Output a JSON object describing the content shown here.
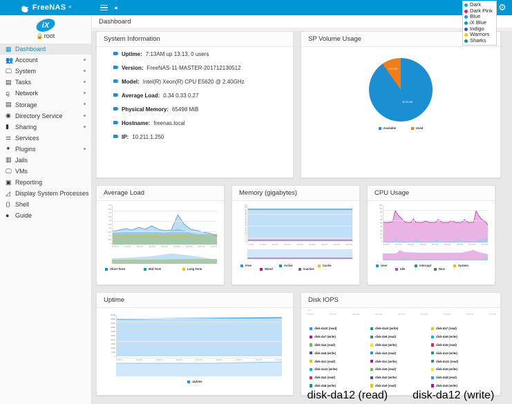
{
  "brand": {
    "name": "FreeNAS",
    "tm": "®"
  },
  "topbar": {
    "menu_icon": "hamburger-icon",
    "collapse_icon": "chevron-left-icon",
    "settings_icon": "gear-icon"
  },
  "theme_menu": {
    "items": [
      {
        "label": "Dark",
        "color": "#00a8e8"
      },
      {
        "label": "Dark Pink",
        "color": "#e91e63"
      },
      {
        "label": "Blue",
        "color": "#1e90ff"
      },
      {
        "label": "iX Blue",
        "color": "#0095d5"
      },
      {
        "label": "Indigo",
        "color": "#3f51b5"
      },
      {
        "label": "Warriors",
        "color": "#ffc107"
      },
      {
        "label": "Sharks",
        "color": "#009688"
      }
    ]
  },
  "breadcrumb": {
    "text": "Dashboard"
  },
  "sidebar": {
    "user": {
      "name": "root",
      "lock_icon": "lock-icon",
      "avatar": "ix-logo-avatar"
    },
    "items": [
      {
        "label": "Dashboard",
        "icon": "dashboard-icon",
        "glyph": "▦",
        "active": true,
        "expandable": false
      },
      {
        "label": "Account",
        "icon": "account-icon",
        "glyph": "👥",
        "active": false,
        "expandable": true
      },
      {
        "label": "System",
        "icon": "system-icon",
        "glyph": "🖵",
        "active": false,
        "expandable": true
      },
      {
        "label": "Tasks",
        "icon": "tasks-calendar-icon",
        "glyph": "▤",
        "active": false,
        "expandable": true
      },
      {
        "label": "Network",
        "icon": "network-icon",
        "glyph": "⚼",
        "active": false,
        "expandable": true
      },
      {
        "label": "Storage",
        "icon": "storage-icon",
        "glyph": "▤",
        "active": false,
        "expandable": true
      },
      {
        "label": "Directory Service",
        "icon": "directory-service-icon",
        "glyph": "◉",
        "active": false,
        "expandable": true
      },
      {
        "label": "Sharing",
        "icon": "sharing-icon",
        "glyph": "▮",
        "active": false,
        "expandable": true
      },
      {
        "label": "Services",
        "icon": "services-sliders-icon",
        "glyph": "⚌",
        "active": false,
        "expandable": false
      },
      {
        "label": "Plugins",
        "icon": "plugins-puzzle-icon",
        "glyph": "✦",
        "active": false,
        "expandable": true
      },
      {
        "label": "Jails",
        "icon": "jails-icon",
        "glyph": "▥",
        "active": false,
        "expandable": false
      },
      {
        "label": "VMs",
        "icon": "vms-monitor-icon",
        "glyph": "🖵",
        "active": false,
        "expandable": false
      },
      {
        "label": "Reporting",
        "icon": "reporting-chart-icon",
        "glyph": "▣",
        "active": false,
        "expandable": false
      },
      {
        "label": "Display System Processes",
        "icon": "processes-icon",
        "glyph": "◿",
        "active": false,
        "expandable": false
      },
      {
        "label": "Shell",
        "icon": "shell-code-icon",
        "glyph": "⟨⟩",
        "active": false,
        "expandable": false
      },
      {
        "label": "Guide",
        "icon": "guide-info-icon",
        "glyph": "●",
        "active": false,
        "expandable": false
      }
    ]
  },
  "cards": {
    "system_information": {
      "title": "System Information",
      "rows": [
        {
          "key": "Uptime:",
          "value": "7:13AM up 13:13, 0 users"
        },
        {
          "key": "Version:",
          "value": "FreeNAS-11-MASTER-201712130512"
        },
        {
          "key": "Model:",
          "value": "Intel(R) Xeon(R) CPU E5620 @ 2.40GHz"
        },
        {
          "key": "Average Load:",
          "value": "0.34 0.33 0.27"
        },
        {
          "key": "Physical Memory:",
          "value": "65498 MiB"
        },
        {
          "key": "Hostname:",
          "value": "freenas.local"
        },
        {
          "key": "IP:",
          "value": "10.211.1.250"
        }
      ]
    },
    "sp_volume_usage": {
      "title": "SP Volume Usage"
    },
    "average_load": {
      "title": "Average Load"
    },
    "memory": {
      "title": "Memory (gigabytes)"
    },
    "cpu_usage": {
      "title": "CPU Usage"
    },
    "uptime": {
      "title": "Uptime"
    },
    "disk_iops": {
      "title": "Disk IOPS"
    }
  },
  "chart_data": [
    {
      "type": "pie",
      "title": "SP Volume Usage",
      "legend_position": "bottom",
      "categories": [
        "Available",
        "Used"
      ],
      "values": [
        42.29,
        7.21
      ],
      "value_labels": [
        "42.29 GiB",
        "7.21 GiB"
      ],
      "colors": [
        "#1b8fd1",
        "#f07d18"
      ]
    },
    {
      "type": "area",
      "title": "Average Load",
      "ylabel": "",
      "xlabel": "",
      "ylim": [
        0,
        0.5
      ],
      "yticks": [
        "0.5",
        "0.45",
        "0.4",
        "0.35",
        "0.3",
        "0.25",
        "0.2",
        "0.15",
        "0.1",
        "0.05",
        "0"
      ],
      "xticks": [
        "07:30:00",
        "07:45:00",
        "08:00:00",
        "08:15:00",
        "08:30:00",
        "08:45:00",
        "09:00:00",
        "09:15:00",
        "09:30:00"
      ],
      "grid": true,
      "series": [
        {
          "name": "Short Term",
          "color": "#1e8bcd",
          "values": [
            0.2,
            0.21,
            0.22,
            0.21,
            0.23,
            0.22,
            0.24,
            0.22,
            0.21,
            0.22,
            0.34,
            0.25,
            0.22,
            0.21,
            0.2,
            0.19,
            0.17,
            0.16,
            0.17,
            0.19,
            0.21,
            0.3,
            0.27,
            0.26,
            0.25,
            0.27,
            0.28,
            0.3,
            0.4,
            0.44,
            0.41,
            0.43,
            0.38,
            0.3,
            0.24
          ]
        },
        {
          "name": "Mid Term",
          "color": "#1aa38c",
          "values": [
            0.19,
            0.2,
            0.2,
            0.2,
            0.21,
            0.2,
            0.21,
            0.2,
            0.2,
            0.2,
            0.24,
            0.21,
            0.2,
            0.19,
            0.18,
            0.15,
            0.12,
            0.11,
            0.13,
            0.17,
            0.19,
            0.22,
            0.22,
            0.22,
            0.22,
            0.23,
            0.23,
            0.24,
            0.26,
            0.27,
            0.27,
            0.27,
            0.26,
            0.24,
            0.22
          ]
        },
        {
          "name": "Long Term",
          "color": "#f2c200",
          "values": [
            0.18,
            0.18,
            0.18,
            0.18,
            0.18,
            0.18,
            0.18,
            0.18,
            0.18,
            0.18,
            0.19,
            0.19,
            0.19,
            0.18,
            0.18,
            0.17,
            0.17,
            0.17,
            0.17,
            0.18,
            0.18,
            0.19,
            0.19,
            0.19,
            0.19,
            0.19,
            0.2,
            0.2,
            0.2,
            0.21,
            0.21,
            0.21,
            0.21,
            0.21,
            0.21
          ]
        }
      ]
    },
    {
      "type": "area",
      "title": "Memory (gigabytes)",
      "ylim": [
        0,
        64
      ],
      "yticks": [
        "64",
        "60",
        "56",
        "52",
        "48",
        "44",
        "40",
        "36",
        "32",
        "28",
        "24",
        "20",
        "16",
        "12",
        "8",
        "4",
        "0"
      ],
      "xticks": [
        "07:30:00",
        "07:45:00",
        "08:00:00",
        "08:15:00",
        "08:30:00",
        "08:45:00",
        "09:00:00",
        "09:15:00",
        "09:30:00"
      ],
      "grid": true,
      "series": [
        {
          "name": "Free",
          "color": "#2196f3",
          "values": [
            60,
            60,
            60,
            60,
            60,
            60,
            60,
            60,
            60
          ]
        },
        {
          "name": "Active",
          "color": "#0f9d8c",
          "values": [
            1,
            1,
            1,
            1,
            1,
            1,
            1,
            1,
            1
          ]
        },
        {
          "name": "Cache",
          "color": "#f2c200",
          "values": [
            0.5,
            0.5,
            0.5,
            0.5,
            0.5,
            0.5,
            0.5,
            0.5,
            0.5
          ]
        },
        {
          "name": "Wired",
          "color": "#b5129b",
          "values": [
            1.5,
            1.5,
            1.5,
            1.5,
            1.5,
            1.5,
            1.5,
            1.5,
            1.5
          ]
        },
        {
          "name": "Inactive",
          "color": "#5c7080",
          "values": [
            1,
            1,
            1,
            1,
            1,
            1,
            1,
            1,
            1
          ]
        }
      ]
    },
    {
      "type": "area",
      "title": "CPU Usage",
      "ylim": [
        0,
        100
      ],
      "yticks": [
        "100",
        "90",
        "80",
        "70",
        "60",
        "50",
        "40",
        "30",
        "20",
        "10",
        "0"
      ],
      "xticks": [
        "07:30:00",
        "07:45:00",
        "08:00:00",
        "08:15:00",
        "08:30:00",
        "08:45:00",
        "09:00:00",
        "09:15:00",
        "09:30:00"
      ],
      "grid": true,
      "series": [
        {
          "name": "User",
          "color": "#2196f3",
          "values": [
            4,
            4,
            5,
            4,
            9,
            5,
            4,
            4,
            5,
            9,
            4,
            4,
            5,
            4,
            9,
            4,
            5,
            4,
            4,
            9,
            5,
            4,
            6,
            12
          ]
        },
        {
          "name": "Interrupt",
          "color": "#0f9d8c",
          "values": [
            1,
            1,
            1,
            1,
            1,
            1,
            1,
            1,
            1,
            1,
            1,
            1,
            1,
            1,
            1,
            1,
            1,
            1,
            1,
            1,
            1,
            1,
            1,
            1
          ]
        },
        {
          "name": "System",
          "color": "#f2c200",
          "values": [
            2,
            2,
            2,
            2,
            2,
            2,
            2,
            2,
            2,
            2,
            2,
            2,
            2,
            2,
            2,
            2,
            2,
            2,
            2,
            2,
            2,
            2,
            2,
            2
          ]
        },
        {
          "name": "Idle",
          "color": "#c840b8",
          "values": [
            62,
            62,
            63,
            62,
            80,
            68,
            62,
            62,
            62,
            64,
            62,
            63,
            62,
            62,
            64,
            62,
            63,
            62,
            62,
            80,
            70,
            64,
            62,
            58
          ]
        },
        {
          "name": "Nice",
          "color": "#5c7080",
          "values": [
            0,
            0,
            0,
            0,
            0,
            0,
            0,
            0,
            0,
            0,
            0,
            0,
            0,
            0,
            0,
            0,
            0,
            0,
            0,
            0,
            0,
            0,
            0,
            0
          ]
        }
      ]
    },
    {
      "type": "area",
      "title": "Uptime",
      "ylim": [
        0,
        50000
      ],
      "yticks": [
        "50000",
        "45000",
        "40000",
        "35000",
        "30000",
        "25000",
        "20000",
        "15000",
        "10000",
        "5000",
        "0"
      ],
      "xticks": [
        "07:30:00",
        "07:45:00",
        "08:00:00",
        "08:15:00",
        "08:30:00",
        "08:45:00",
        "09:00:00",
        "09:15:00",
        "09:30:00"
      ],
      "grid": true,
      "series": [
        {
          "name": "Uptime",
          "color": "#2196f3",
          "values": [
            46000,
            46200,
            46400,
            46600,
            46800,
            47000,
            47200,
            47400,
            47600
          ]
        }
      ]
    },
    {
      "type": "line",
      "title": "Disk IOPS",
      "yticks": [
        "1.0"
      ],
      "xticks": [
        "07:30:00",
        "07:45:00",
        "08:00:00",
        "08:15:00",
        "08:30:00",
        "08:45:00",
        "09:00:00",
        "09:15:00",
        "09:30:00"
      ],
      "grid": false,
      "legend_position": "bottom",
      "series": [
        {
          "name": "disk-da10 (read)",
          "color": "#2196f3"
        },
        {
          "name": "disk-da10 (write)",
          "color": "#0f9d8c"
        },
        {
          "name": "disk-da7 (read)",
          "color": "#f2c200"
        },
        {
          "name": "disk-da7 (write)",
          "color": "#b5129b"
        },
        {
          "name": "disk-da9 (read)",
          "color": "#4a7c93"
        },
        {
          "name": "disk-da9 (write)",
          "color": "#00bcd4"
        },
        {
          "name": "disk-da4 (read)",
          "color": "#5cc94a"
        },
        {
          "name": "disk-da4 (write)",
          "color": "#ffe600"
        },
        {
          "name": "disk-da6 (read)",
          "color": "#e91e63"
        },
        {
          "name": "disk-da6 (write)",
          "color": "#3f51b5"
        },
        {
          "name": "disk-da3 (read)",
          "color": "#2196f3"
        },
        {
          "name": "disk-da3 (write)",
          "color": "#0f9d8c"
        },
        {
          "name": "disk-da1 (read)",
          "color": "#f2c200"
        },
        {
          "name": "disk-da1 (write)",
          "color": "#b5129b"
        },
        {
          "name": "disk-da11 (read)",
          "color": "#4a7c93"
        },
        {
          "name": "disk-da11 (write)",
          "color": "#00bcd4"
        },
        {
          "name": "disk-da5 (read)",
          "color": "#5cc94a"
        },
        {
          "name": "disk-da5 (write)",
          "color": "#ffe600"
        },
        {
          "name": "disk-da2 (read)",
          "color": "#e91e63"
        },
        {
          "name": "disk-da2 (write)",
          "color": "#3f51b5"
        },
        {
          "name": "disk-da8 (read)",
          "color": "#2196f3"
        },
        {
          "name": "disk-da8 (write)",
          "color": "#0f9d8c"
        },
        {
          "name": "disk-da0 (read)",
          "color": "#f2c200"
        },
        {
          "name": "disk-da0 (write)",
          "color": "#b5129b"
        },
        {
          "name": "disk-da12 (read)",
          "color": "#4a7c93"
        },
        {
          "name": "disk-da12 (write)",
          "color": "#00bcd4"
        }
      ]
    }
  ]
}
